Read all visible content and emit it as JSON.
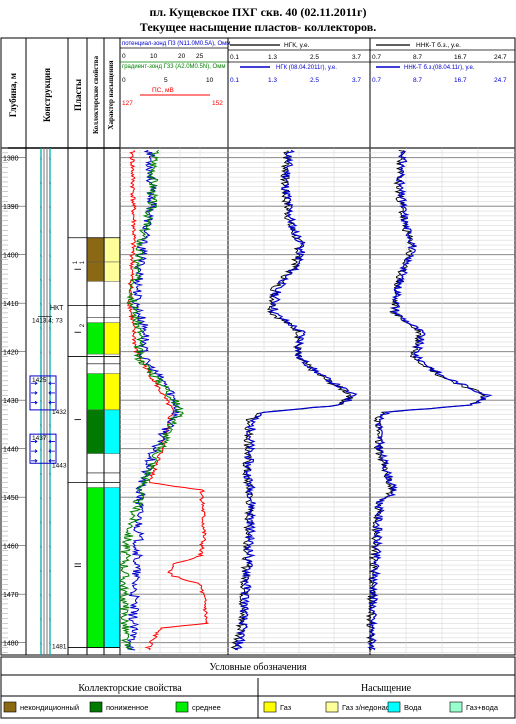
{
  "title": {
    "line1": "пл. Кущевское ПХГ скв. 40 (02.11.2011г)",
    "line2": "Текущее насыщение пластов- коллекторов."
  },
  "columns": {
    "depth": "Глубина, м",
    "construction": "Конструкция",
    "layers": "Пласты",
    "collector": "Коллекторские свойства",
    "saturation": "Характер насыщения"
  },
  "tracks": {
    "resistivity": {
      "curve1": "потенциал-зонд П3 (N11.0M0.5A), Омм",
      "curve2": "градиент-зонд Г33 (A2.0M0.5N), Омм",
      "scale_ticks": [
        "0",
        "10",
        "20",
        "25"
      ],
      "sp_label": "ПС, мВ",
      "sp_ticks": [
        "0",
        "5",
        "10"
      ],
      "sp_range": [
        "127",
        "152"
      ]
    },
    "ngk": {
      "label1": "НГК, у.е.",
      "label2": "НГК (08.04.2011г), у.е.",
      "ticks": [
        "0.1",
        "1.3",
        "2.5",
        "3.7"
      ],
      "ticks2": [
        "0.1",
        "1.3",
        "2.5",
        "3.7"
      ]
    },
    "nnk": {
      "label1": "ННК-Т б.з., у.е.",
      "label2": "ННК-Т б.з.(08.04.11г), у.е.",
      "ticks": [
        "0.7",
        "8.7",
        "16.7",
        "24.7"
      ],
      "ticks2": [
        "0.7",
        "8.7",
        "16.7",
        "24.7"
      ]
    }
  },
  "depth_labels": [
    "1380",
    "1390",
    "1400",
    "1410",
    "1420",
    "1430",
    "1440",
    "1450",
    "1460",
    "1470",
    "1480"
  ],
  "construction": {
    "nkt_label": "НКТ",
    "nkt_depth": "1413.4; 73",
    "marks": [
      "1425",
      "1432",
      "1437",
      "1443",
      "1481"
    ]
  },
  "layers": [
    {
      "name": "I",
      "sub": "1",
      "sup": "1"
    },
    {
      "name": "I",
      "sub": "2",
      "sup": ""
    },
    {
      "name": "I",
      "sub": "",
      "sup": ""
    },
    {
      "name": "II",
      "sub": "",
      "sup": ""
    }
  ],
  "legend": {
    "title": "Условные обозначения",
    "collector_title": "Коллекторские свойства",
    "collector_items": [
      {
        "label": "некондиционный",
        "color": "#8b6914"
      },
      {
        "label": "пониженное",
        "color": "#007a00"
      },
      {
        "label": "среднее",
        "color": "#00ee00"
      }
    ],
    "saturation_title": "Насыщение",
    "saturation_items": [
      {
        "label": "Газ",
        "color": "#ffff00"
      },
      {
        "label": "Газ з/недонас",
        "color": "#ffff99"
      },
      {
        "label": "Вода",
        "color": "#00ffff"
      },
      {
        "label": "Газ+вода",
        "color": "#99ffcc"
      }
    ]
  },
  "colors": {
    "collector_poor": "#8b6914",
    "collector_low": "#007a00",
    "collector_mid": "#00ee00",
    "gas": "#ffff00",
    "gas_under": "#ffff99",
    "water": "#00ffff",
    "blue_curve": "#0000cc",
    "green_curve": "#008000",
    "red_curve": "#ff0000"
  }
}
